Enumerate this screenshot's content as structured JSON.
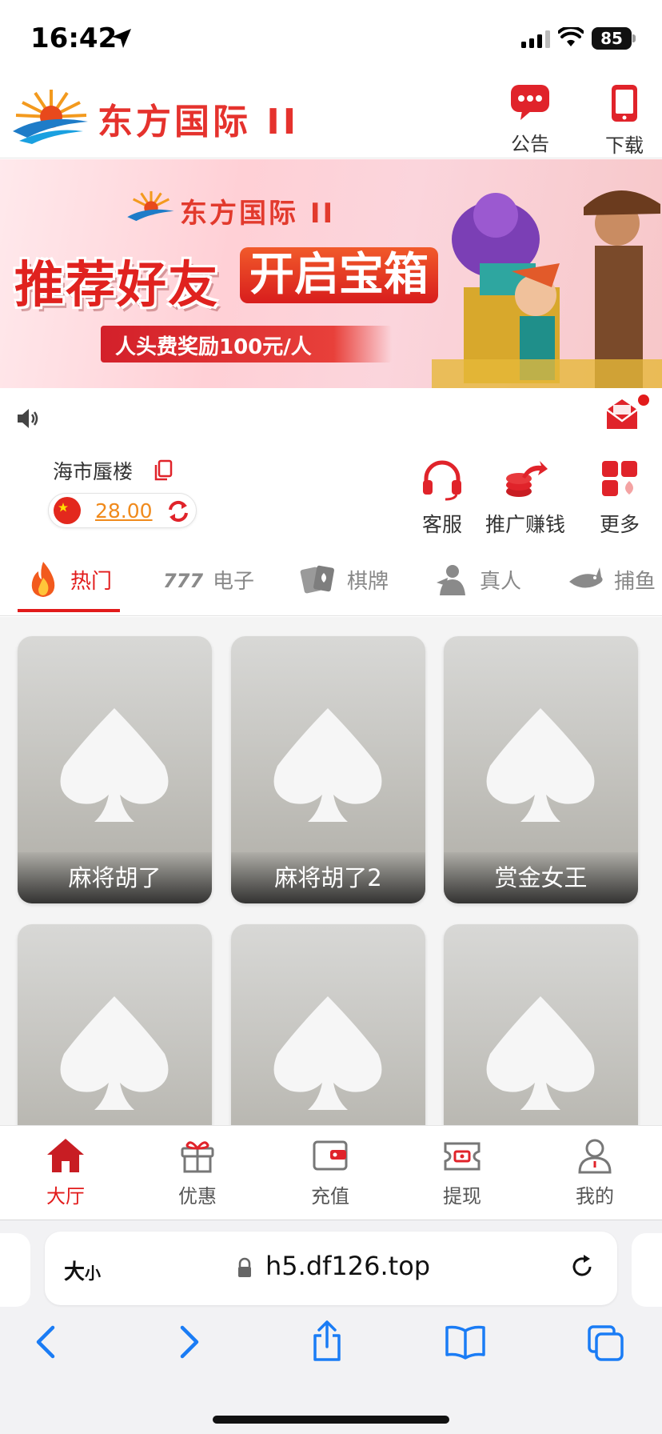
{
  "status": {
    "time": "16:42",
    "battery": "85"
  },
  "header": {
    "brand": "东方国际 II",
    "announce_label": "公告",
    "download_label": "下载"
  },
  "banner": {
    "brand": "东方国际 II",
    "slogan1": "推荐好友",
    "slogan2": "开启宝箱",
    "reward": "人头费奖励100元/人"
  },
  "user": {
    "name": "海市蜃楼",
    "balance": "28.00"
  },
  "quick_actions": [
    {
      "label": "客服",
      "icon": "headset-icon"
    },
    {
      "label": "推广赚钱",
      "icon": "promote-icon"
    },
    {
      "label": "更多",
      "icon": "more-grid-icon"
    }
  ],
  "tabs": [
    {
      "label": "热门",
      "icon": "fire-icon",
      "active": true
    },
    {
      "label": "电子",
      "icon": "slot-777-icon"
    },
    {
      "label": "棋牌",
      "icon": "cards-icon"
    },
    {
      "label": "真人",
      "icon": "dealer-icon"
    },
    {
      "label": "捕鱼",
      "icon": "shark-icon"
    }
  ],
  "games": [
    {
      "name": "麻将胡了"
    },
    {
      "name": "麻将胡了2"
    },
    {
      "name": "赏金女王"
    },
    {
      "name": ""
    },
    {
      "name": ""
    },
    {
      "name": ""
    }
  ],
  "bottom_nav": [
    {
      "label": "大厅",
      "icon": "home-icon",
      "active": true
    },
    {
      "label": "优惠",
      "icon": "gift-icon"
    },
    {
      "label": "充值",
      "icon": "wallet-icon"
    },
    {
      "label": "提现",
      "icon": "withdraw-icon"
    },
    {
      "label": "我的",
      "icon": "user-icon"
    }
  ],
  "browser": {
    "text_size_label": "大",
    "text_size_small": "小",
    "url": "h5.df126.top"
  },
  "colors": {
    "accent": "#e21b1b",
    "balance": "#f08a1c"
  }
}
